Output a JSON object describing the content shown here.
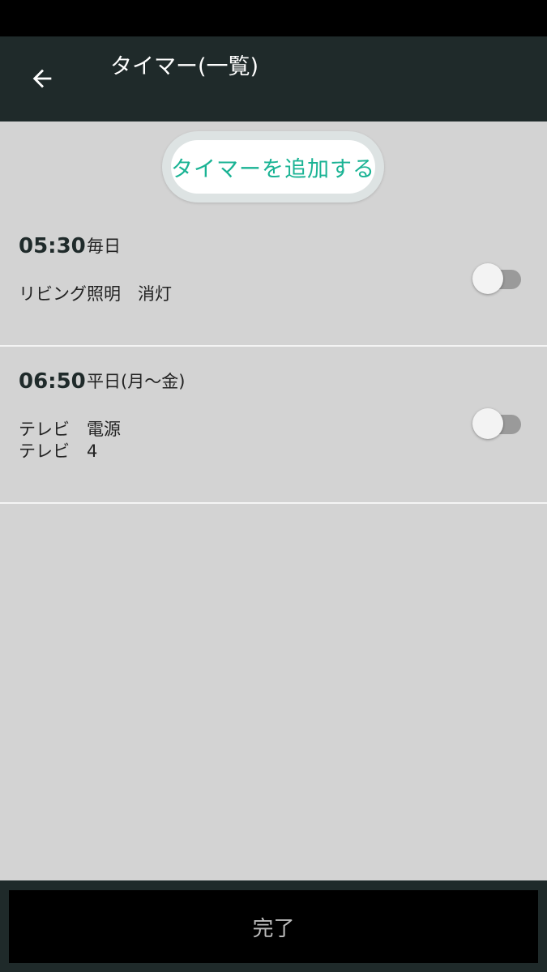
{
  "header": {
    "title": "タイマー(一覧)",
    "back_icon": "arrow-left-icon"
  },
  "add_button": {
    "label": "タイマーを追加する"
  },
  "timers": [
    {
      "time": "05:30",
      "repeat": "毎日",
      "actions": [
        "リビング照明　消灯"
      ],
      "enabled": false
    },
    {
      "time": "06:50",
      "repeat": "平日(月〜金)",
      "actions": [
        "テレビ　電源",
        "テレビ　4"
      ],
      "enabled": false
    }
  ],
  "footer": {
    "done_label": "完了"
  },
  "colors": {
    "app_bar": "#1f2a2a",
    "background": "#d3d3d3",
    "accent": "#1ab394",
    "status_bar": "#000000"
  }
}
